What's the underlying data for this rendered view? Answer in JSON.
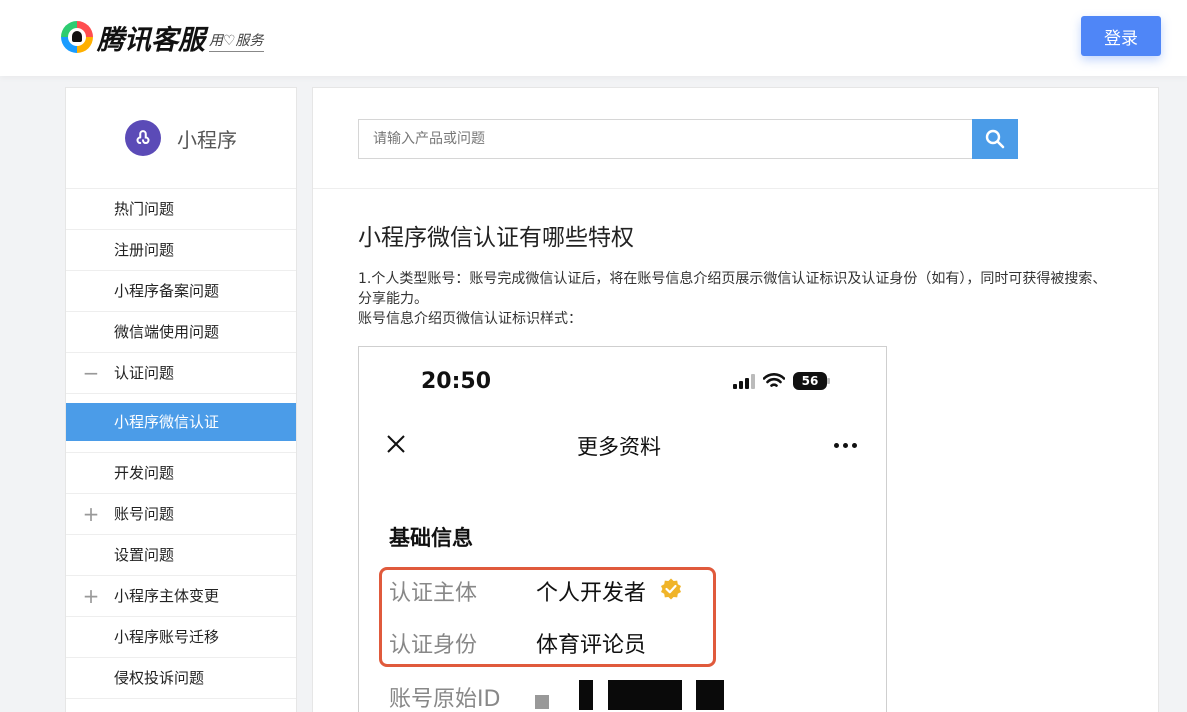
{
  "header": {
    "logo_text": "腾讯客服",
    "logo_slogan": "用♡服务",
    "login_label": "登录"
  },
  "sidebar": {
    "product_title": "小程序",
    "items": [
      {
        "label": "热门问题",
        "toggle": ""
      },
      {
        "label": "注册问题",
        "toggle": ""
      },
      {
        "label": "小程序备案问题",
        "toggle": ""
      },
      {
        "label": "微信端使用问题",
        "toggle": ""
      },
      {
        "label": "认证问题",
        "toggle": "−"
      },
      {
        "label": "小程序微信认证",
        "toggle": "",
        "active": true
      },
      {
        "label": "开发问题",
        "toggle": ""
      },
      {
        "label": "账号问题",
        "toggle": "+"
      },
      {
        "label": "设置问题",
        "toggle": ""
      },
      {
        "label": "小程序主体变更",
        "toggle": "+"
      },
      {
        "label": "小程序账号迁移",
        "toggle": ""
      },
      {
        "label": "侵权投诉问题",
        "toggle": ""
      }
    ]
  },
  "search": {
    "placeholder": "请输入产品或问题",
    "value": ""
  },
  "article": {
    "title": "小程序微信认证有哪些特权",
    "para1": "1.个人类型账号：账号完成微信认证后，将在账号信息介绍页展示微信认证标识及认证身份（如有），同时可获得被搜索、分享能力。",
    "para2": "账号信息介绍页微信认证标识样式："
  },
  "phone": {
    "time": "20:50",
    "battery": "56",
    "nav_title": "更多资料",
    "section_title": "基础信息",
    "rows": [
      {
        "label": "认证主体",
        "value": "个人开发者"
      },
      {
        "label": "认证身份",
        "value": "体育评论员"
      },
      {
        "label": "账号原始ID",
        "value": ""
      }
    ],
    "highlight_color": "#e05a3c",
    "badge_color": "#f0b429"
  },
  "colors": {
    "accent": "#4f86f7",
    "active_menu": "#4b9ce8",
    "product_icon": "#5b4bb7"
  }
}
